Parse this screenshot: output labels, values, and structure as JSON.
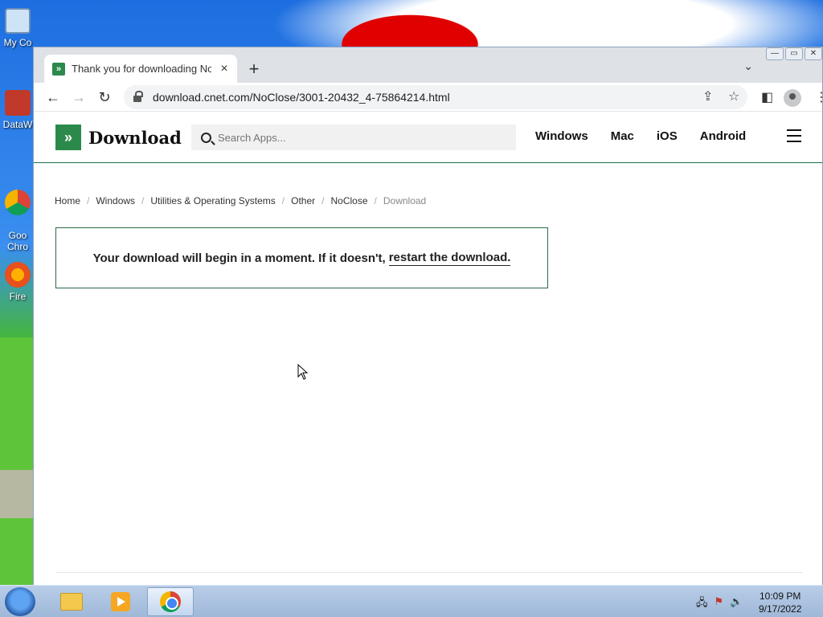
{
  "desktop": {
    "icons": [
      {
        "label": "My Co"
      },
      {
        "label": "DataW"
      },
      {
        "label": "Goo\nChro"
      },
      {
        "label": "Fire"
      }
    ]
  },
  "browser": {
    "tab_title": "Thank you for downloading NoC",
    "url": "download.cnet.com/NoClose/3001-20432_4-75864214.html",
    "window_buttons": {
      "minimize": "—",
      "restore": "▭",
      "close": "✕"
    }
  },
  "site": {
    "logo_text": "Download",
    "search_placeholder": "Search Apps...",
    "nav": [
      "Windows",
      "Mac",
      "iOS",
      "Android"
    ]
  },
  "breadcrumb": [
    "Home",
    "Windows",
    "Utilities & Operating Systems",
    "Other",
    "NoClose",
    "Download"
  ],
  "notice": {
    "text": "Your download will begin in a moment. If it doesn't,",
    "link": "restart the download."
  },
  "taskbar": {
    "time": "10:09 PM",
    "date": "9/17/2022"
  },
  "colors": {
    "brand_green": "#2b8a4b",
    "notice_border": "#2b6a47"
  }
}
